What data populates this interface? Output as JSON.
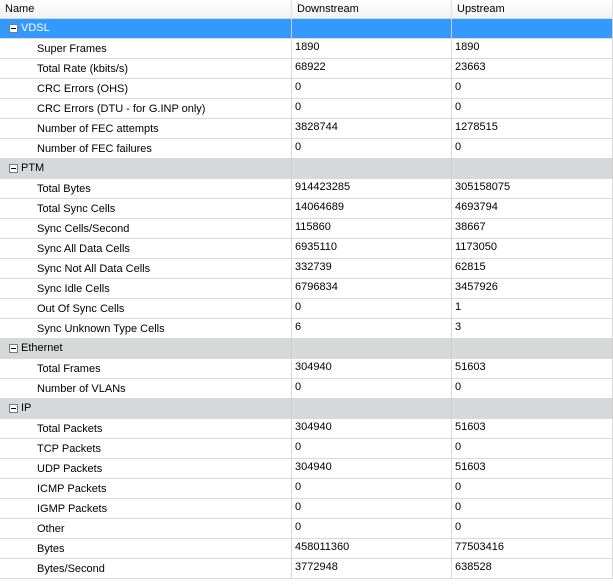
{
  "columns": [
    "Name",
    "Downstream",
    "Upstream"
  ],
  "groups": [
    {
      "name": "VDSL",
      "selected": true,
      "rows": [
        {
          "name": "Super Frames",
          "down": "1890",
          "up": "1890"
        },
        {
          "name": "Total Rate (kbits/s)",
          "down": "68922",
          "up": "23663"
        },
        {
          "name": "CRC Errors (OHS)",
          "down": "0",
          "up": "0"
        },
        {
          "name": "CRC Errors (DTU - for G.INP only)",
          "down": "0",
          "up": "0"
        },
        {
          "name": "Number of FEC attempts",
          "down": "3828744",
          "up": "1278515"
        },
        {
          "name": "Number of FEC failures",
          "down": "0",
          "up": "0"
        }
      ]
    },
    {
      "name": "PTM",
      "selected": false,
      "rows": [
        {
          "name": "Total Bytes",
          "down": "914423285",
          "up": "305158075"
        },
        {
          "name": "Total Sync Cells",
          "down": "14064689",
          "up": "4693794"
        },
        {
          "name": "Sync Cells/Second",
          "down": "115860",
          "up": "38667"
        },
        {
          "name": "Sync All Data Cells",
          "down": "6935110",
          "up": "1173050"
        },
        {
          "name": "Sync Not All Data Cells",
          "down": "332739",
          "up": "62815"
        },
        {
          "name": "Sync Idle Cells",
          "down": "6796834",
          "up": "3457926"
        },
        {
          "name": "Out Of Sync Cells",
          "down": "0",
          "up": "1"
        },
        {
          "name": "Sync Unknown Type Cells",
          "down": "6",
          "up": "3"
        }
      ]
    },
    {
      "name": "Ethernet",
      "selected": false,
      "rows": [
        {
          "name": "Total Frames",
          "down": "304940",
          "up": "51603"
        },
        {
          "name": "Number of VLANs",
          "down": "0",
          "up": "0"
        }
      ]
    },
    {
      "name": "IP",
      "selected": false,
      "rows": [
        {
          "name": "Total Packets",
          "down": "304940",
          "up": "51603"
        },
        {
          "name": "TCP Packets",
          "down": "0",
          "up": "0"
        },
        {
          "name": "UDP Packets",
          "down": "304940",
          "up": "51603"
        },
        {
          "name": "ICMP Packets",
          "down": "0",
          "up": "0"
        },
        {
          "name": "IGMP Packets",
          "down": "0",
          "up": "0"
        },
        {
          "name": "Other",
          "down": "0",
          "up": "0"
        },
        {
          "name": "Bytes",
          "down": "458011360",
          "up": "77503416"
        },
        {
          "name": "Bytes/Second",
          "down": "3772948",
          "up": "638528"
        }
      ]
    }
  ],
  "colors": {
    "selection": "#3399ff",
    "group_background": "#d7d8da",
    "grid_line": "#d9d9d9"
  }
}
